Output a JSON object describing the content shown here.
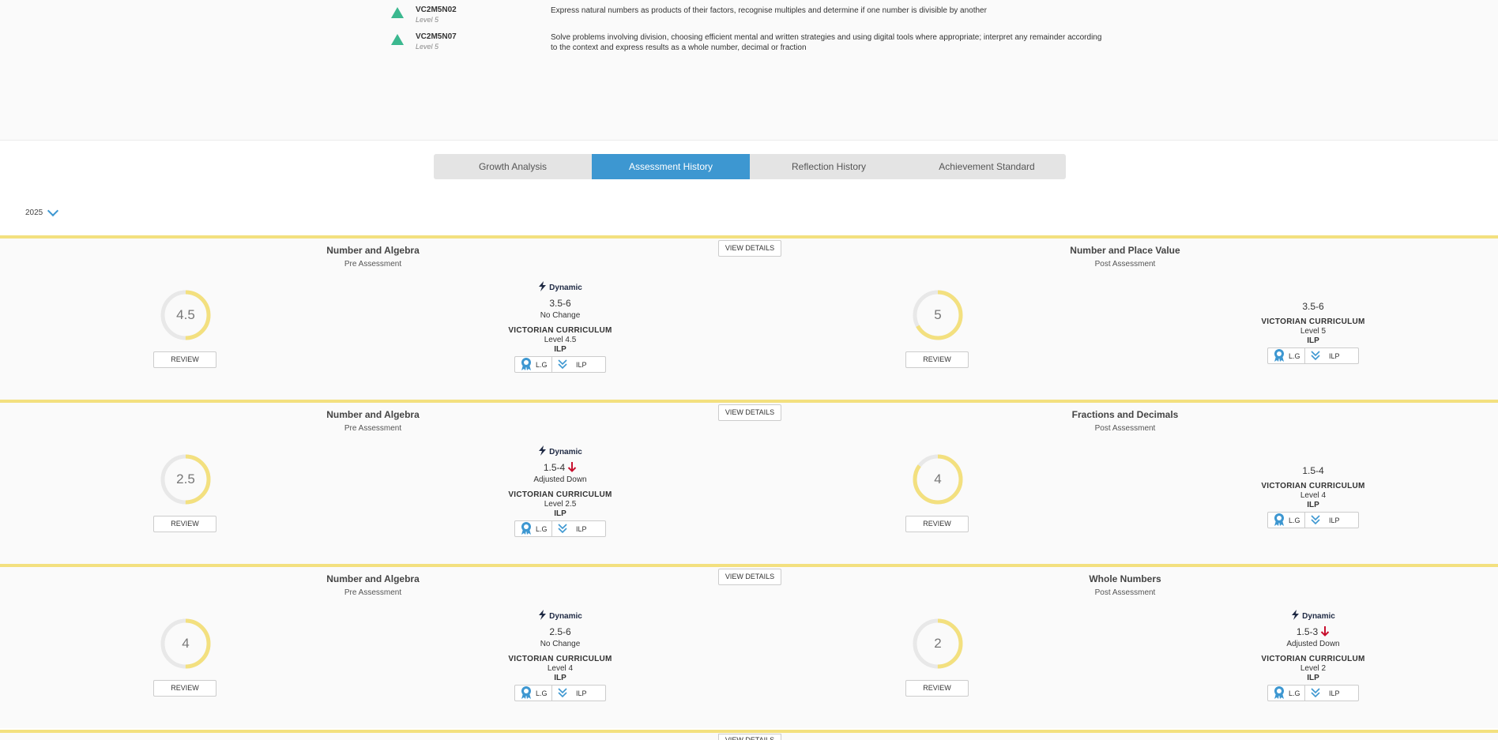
{
  "outcomes": [
    {
      "code": "VC2M5N02",
      "level": "Level 5",
      "description": "Express natural numbers as products of their factors, recognise multiples and determine if one number is divisible by another"
    },
    {
      "code": "VC2M5N07",
      "level": "Level 5",
      "description": "Solve problems involving division, choosing efficient mental and written strategies and using digital tools where appropriate; interpret any remainder according to the context and express results as a whole number, decimal or fraction"
    }
  ],
  "tabs": [
    {
      "label": "Growth Analysis",
      "active": false
    },
    {
      "label": "Assessment History",
      "active": true
    },
    {
      "label": "Reflection History",
      "active": false
    },
    {
      "label": "Achievement Standard",
      "active": false
    }
  ],
  "year": "2025",
  "view_details_label": "VIEW DETAILS",
  "review_label": "REVIEW",
  "dynamic_label": "Dynamic",
  "curriculum_label": "VICTORIAN CURRICULUM",
  "ilp_label": "ILP",
  "lg_button": "L.G",
  "ilp_button": "ILP",
  "colors": {
    "accent": "#3d97d1",
    "ring": "#f3e07f",
    "ring_track": "#e8e8e8",
    "triangle": "#3bb88f",
    "down": "#c8102e"
  },
  "cards": [
    {
      "pre": {
        "title": "Number and Algebra",
        "type": "Pre Assessment",
        "score": "4.5",
        "fill": 0.5,
        "dynamic": true,
        "range": "3.5-6",
        "trend": "",
        "change": "No Change",
        "level": "Level 4.5"
      },
      "post": {
        "title": "Number and Place Value",
        "type": "Post Assessment",
        "score": "5",
        "fill": 0.67,
        "dynamic": false,
        "range": "3.5-6",
        "trend": "",
        "change": "",
        "level": "Level 5"
      }
    },
    {
      "pre": {
        "title": "Number and Algebra",
        "type": "Pre Assessment",
        "score": "2.5",
        "fill": 0.5,
        "dynamic": true,
        "range": "1.5-4",
        "trend": "down",
        "change": "Adjusted Down",
        "level": "Level 2.5"
      },
      "post": {
        "title": "Fractions and Decimals",
        "type": "Post Assessment",
        "score": "4",
        "fill": 0.85,
        "dynamic": false,
        "range": "1.5-4",
        "trend": "",
        "change": "",
        "level": "Level 4"
      }
    },
    {
      "pre": {
        "title": "Number and Algebra",
        "type": "Pre Assessment",
        "score": "4",
        "fill": 0.5,
        "dynamic": true,
        "range": "2.5-6",
        "trend": "",
        "change": "No Change",
        "level": "Level 4"
      },
      "post": {
        "title": "Whole Numbers",
        "type": "Post Assessment",
        "score": "2",
        "fill": 0.5,
        "dynamic": true,
        "range": "1.5-3",
        "trend": "down",
        "change": "Adjusted Down",
        "level": "Level 2"
      }
    }
  ]
}
